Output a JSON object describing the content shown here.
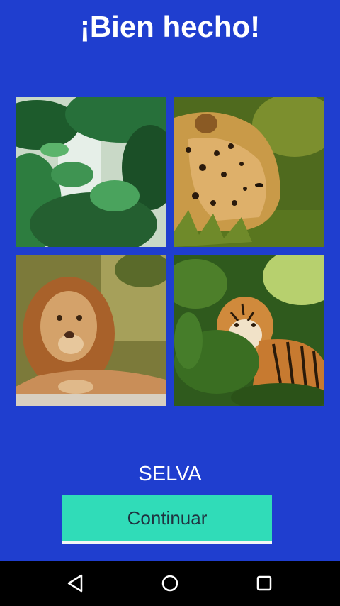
{
  "header": {
    "title": "¡Bien hecho!"
  },
  "images": [
    {
      "name": "jungle-photo",
      "subject": "jungle"
    },
    {
      "name": "jaguar-photo",
      "subject": "jaguar"
    },
    {
      "name": "lion-photo",
      "subject": "lion"
    },
    {
      "name": "tiger-photo",
      "subject": "tiger"
    }
  ],
  "answer": {
    "word": "SELVA"
  },
  "actions": {
    "continue_label": "Continuar"
  },
  "navbar": {
    "back_icon": "back-triangle",
    "home_icon": "home-circle",
    "recent_icon": "recent-square"
  },
  "colors": {
    "background": "#1f3ecf",
    "button": "#30dcb8",
    "navbar": "#000000"
  }
}
